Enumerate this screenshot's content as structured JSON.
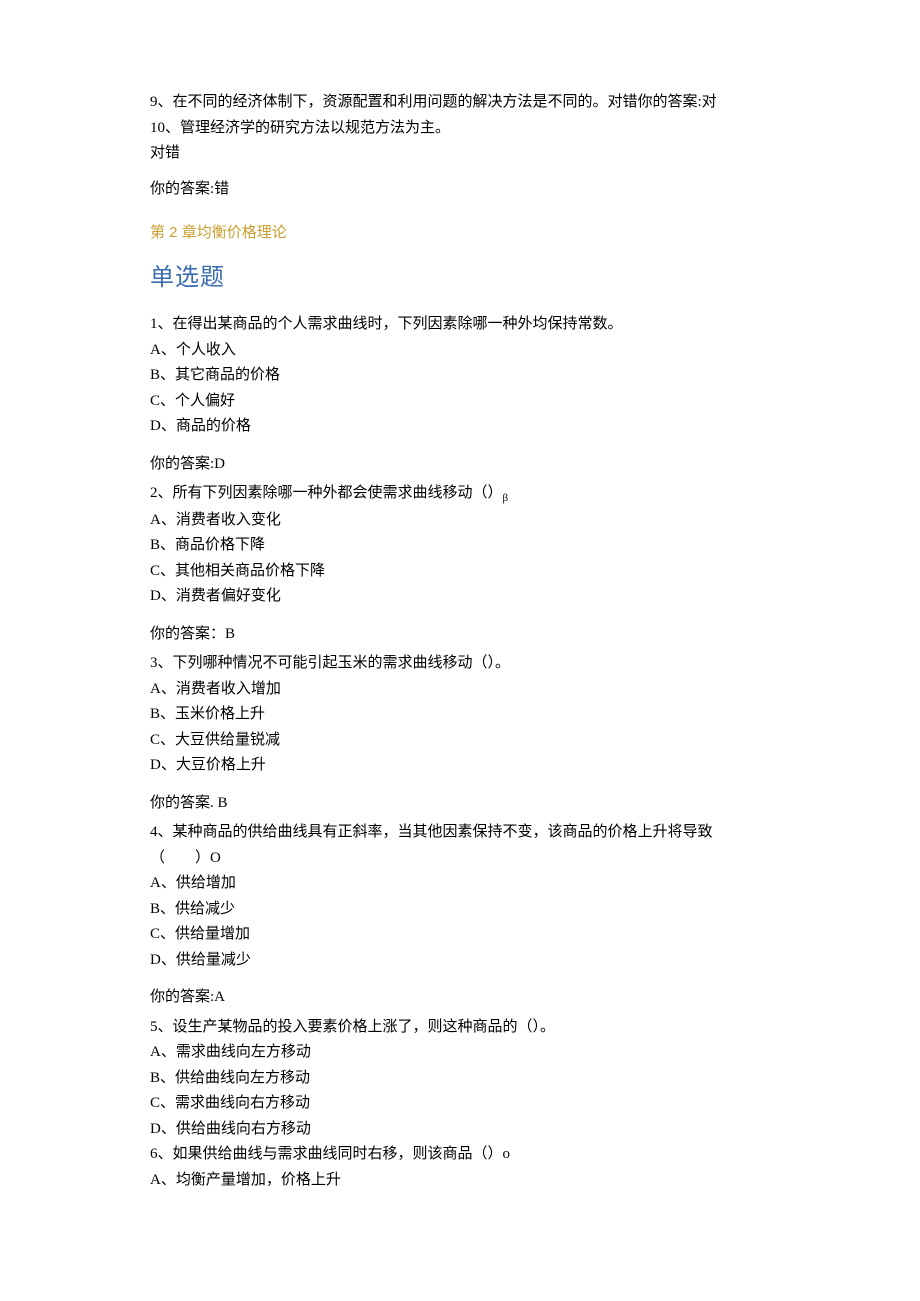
{
  "intro": {
    "q9": "9、在不同的经济体制下，资源配置和利用问题的解决方法是不同的。对错你的答案:对",
    "q10": "10、管理经济学的研究方法以规范方法为主。",
    "true_false": "对错",
    "your_answer_wrong": "你的答案:错"
  },
  "chapter": {
    "title_prefix": "第 ",
    "title_num": "2 ",
    "title_suffix": "章均衡价格理论"
  },
  "section_title": "单选题",
  "q1": {
    "stem": "1、在得出某商品的个人需求曲线时，下列因素除哪一种外均保持常数。",
    "optA": "A、个人收入",
    "optB": "B、其它商品的价格",
    "optC": "C、个人偏好",
    "optD": "D、商品的价格",
    "answer": "你的答案:D"
  },
  "q2": {
    "stem_prefix": "2、所有下列因素除哪一种外都会使需求曲线移动（）",
    "beta": "β",
    "optA": "A、消费者收入变化",
    "optB": "B、商品价格下降",
    "optC": "C、其他相关商品价格下降",
    "optD": "D、消费者偏好变化",
    "answer": "你的答案：B"
  },
  "q3": {
    "stem": "3、下列哪种情况不可能引起玉米的需求曲线移动（）。",
    "optA": "A、消费者收入增加",
    "optB": "B、玉米价格上升",
    "optC": "C、大豆供给量锐减",
    "optD": "D、大豆价格上升",
    "answer": "你的答案. B"
  },
  "q4": {
    "stem_l1": "4、某种商品的供给曲线具有正斜率，当其他因素保持不变，该商品的价格上升将导致",
    "stem_l2": "（　　）O",
    "optA": "A、供给增加",
    "optB": "B、供给减少",
    "optC": "C、供给量增加",
    "optD": "D、供给量减少",
    "answer": "你的答案:A"
  },
  "q5": {
    "stem": "5、设生产某物品的投入要素价格上涨了，则这种商品的（）。",
    "optA": "A、需求曲线向左方移动",
    "optB": "B、供给曲线向左方移动",
    "optC": "C、需求曲线向右方移动",
    "optD": "D、供给曲线向右方移动"
  },
  "q6": {
    "stem": "6、如果供给曲线与需求曲线同时右移，则该商品（）o",
    "optA": "A、均衡产量增加，价格上升"
  }
}
